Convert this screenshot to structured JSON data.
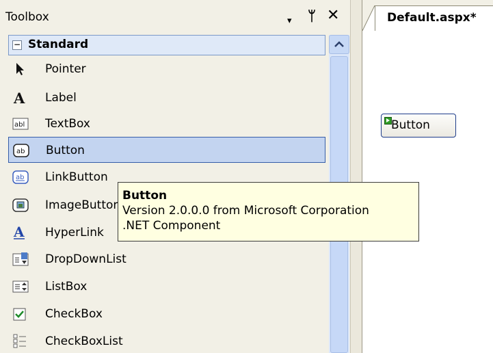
{
  "toolbox": {
    "title": "Toolbox",
    "controls": {
      "dropdown": "▾",
      "pin": "ᛘ",
      "close": "✕"
    },
    "category": {
      "expander": "−",
      "label": "Standard"
    },
    "items": [
      {
        "label": "Pointer",
        "icon": "pointer-icon"
      },
      {
        "label": "Label",
        "icon": "label-icon"
      },
      {
        "label": "TextBox",
        "icon": "textbox-icon"
      },
      {
        "label": "Button",
        "icon": "button-icon",
        "selected": true
      },
      {
        "label": "LinkButton",
        "icon": "linkbutton-icon"
      },
      {
        "label": "ImageButton",
        "icon": "imagebutton-icon"
      },
      {
        "label": "HyperLink",
        "icon": "hyperlink-icon"
      },
      {
        "label": "DropDownList",
        "icon": "dropdownlist-icon"
      },
      {
        "label": "ListBox",
        "icon": "listbox-icon"
      },
      {
        "label": "CheckBox",
        "icon": "checkbox-icon"
      },
      {
        "label": "CheckBoxList",
        "icon": "checkboxlist-icon"
      }
    ]
  },
  "designer": {
    "tab_label": "Default.aspx*",
    "placed_button_label": "Button"
  },
  "tooltip": {
    "title": "Button",
    "line1": "Version 2.0.0.0 from Microsoft Corporation",
    "line2": ".NET Component"
  }
}
